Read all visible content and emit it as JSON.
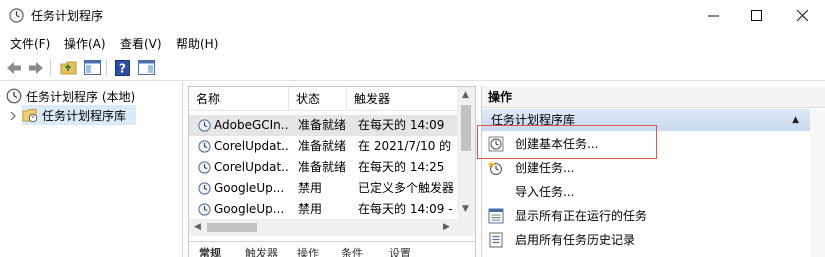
{
  "window": {
    "title": "任务计划程序",
    "minimize_icon": "minimize-icon",
    "maximize_icon": "maximize-icon",
    "close_icon": "close-icon"
  },
  "menu": {
    "items": [
      "文件(F)",
      "操作(A)",
      "查看(V)",
      "帮助(H)"
    ]
  },
  "toolbar": {
    "buttons": [
      "back-arrow-icon",
      "forward-arrow-icon",
      "folder-up-icon",
      "show-hide-tree-icon",
      "help-icon",
      "show-hide-action-pane-icon"
    ]
  },
  "tree": {
    "root": "任务计划程序 (本地)",
    "child": "任务计划程序库"
  },
  "tasks": {
    "columns": [
      "名称",
      "状态",
      "触发器"
    ],
    "rows": [
      {
        "name": "AdobeGCIn...",
        "status": "准备就绪",
        "trigger": "在每天的 14:09"
      },
      {
        "name": "CorelUpdat...",
        "status": "准备就绪",
        "trigger": "在 2021/7/10 的"
      },
      {
        "name": "CorelUpdat...",
        "status": "准备就绪",
        "trigger": "在每天的 14:25"
      },
      {
        "name": "GoogleUp...",
        "status": "禁用",
        "trigger": "已定义多个触发器"
      },
      {
        "name": "GoogleUp...",
        "status": "禁用",
        "trigger": "在每天的 14:09 -"
      }
    ],
    "bottom_tabs": [
      "常规",
      "触发器",
      "操作",
      "条件",
      "设置"
    ]
  },
  "actions": {
    "title": "操作",
    "section": "任务计划程序库",
    "items": [
      {
        "label": "创建基本任务...",
        "icon": "create-basic-task-icon"
      },
      {
        "label": "创建任务...",
        "icon": "create-task-icon"
      },
      {
        "label": "导入任务...",
        "icon": ""
      },
      {
        "label": "显示所有正在运行的任务",
        "icon": "running-tasks-icon"
      },
      {
        "label": "启用所有任务历史记录",
        "icon": "history-icon"
      }
    ]
  },
  "colors": {
    "selected_tree": "#d9ebf9",
    "selected_row": "#e5e5e5",
    "section_header": "#c6d9ef",
    "highlight_box": "#e25545"
  }
}
